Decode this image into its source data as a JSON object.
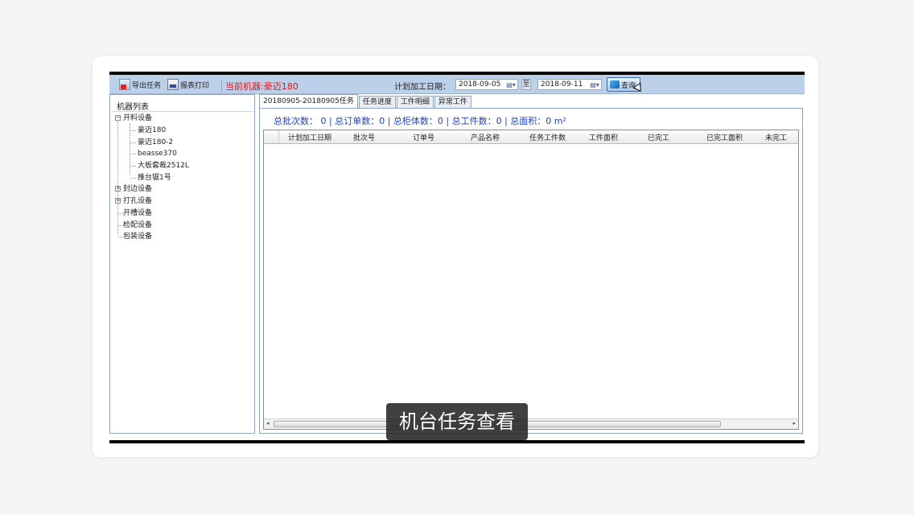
{
  "toolbar": {
    "export_label": "导出任务",
    "print_label": "报表打印",
    "current_machine": "当前机器:豪迈180",
    "date_label": "计划加工日期：",
    "date_from": "2018-09-05",
    "to_label": "至",
    "date_to": "2018-09-11",
    "query_label": "查询"
  },
  "sidebar": {
    "title": "机器列表",
    "groups": [
      {
        "label": "开料设备",
        "children": [
          "豪迈180",
          "豪迈180-2",
          "beasse370",
          "大板套裁2512L",
          "推台锯1号"
        ]
      },
      {
        "label": "封边设备"
      },
      {
        "label": "打孔设备"
      },
      {
        "label": "开槽设备"
      },
      {
        "label": "检配设备"
      },
      {
        "label": "包装设备"
      }
    ]
  },
  "tabs": [
    "20180905-20180905任务",
    "任务进度",
    "工件明细",
    "异常工件"
  ],
  "summary": "总批次数： 0  |  总订单数：0  |  总柜体数：0  |  总工件数：0  |  总面积：0 m²",
  "table": {
    "columns": [
      "计划加工日期",
      "批次号",
      "订单号",
      "产品名称",
      "任务工件数",
      "工件面积",
      "已完工",
      "已完工面积",
      "未完工"
    ]
  },
  "caption": "机台任务查看",
  "colors": {
    "accent": "#1f3fc3",
    "machine": "#e01818",
    "toolbar": "#bcd0ea"
  }
}
